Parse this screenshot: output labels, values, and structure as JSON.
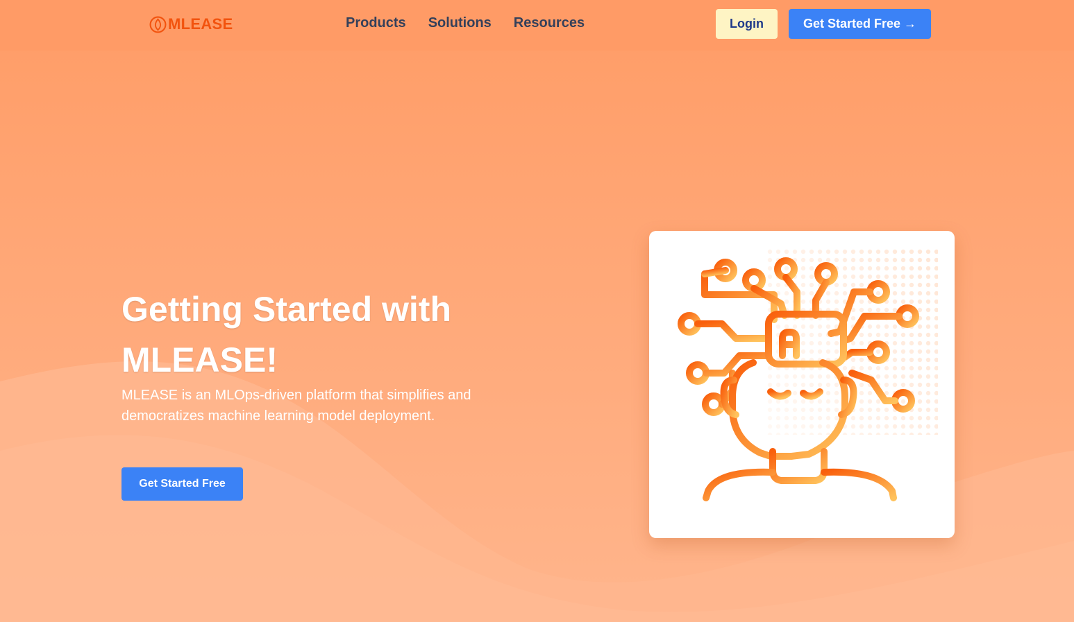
{
  "brand": {
    "name": "MLEASE",
    "logo_icon": "flame-drop-icon",
    "color": "#f2530e"
  },
  "nav": {
    "links": [
      {
        "label": "Products"
      },
      {
        "label": "Solutions"
      },
      {
        "label": "Resources"
      }
    ],
    "login_label": "Login",
    "cta_label": "Get Started Free →"
  },
  "hero": {
    "title": "Getting Started with MLEASE!",
    "description": "MLEASE is an MLOps-driven platform that simplifies and democratizes machine learning model deployment.",
    "cta_label": "Get Started Free",
    "illustration": {
      "icon": "ai-brain-head-icon",
      "badge_text": "AI"
    }
  },
  "colors": {
    "accent": "#3b82f6",
    "login_bg": "#fef4c4",
    "nav_text": "#34405a",
    "background": "#ffa878",
    "illustration_gradient_start": "#f95f0c",
    "illustration_gradient_end": "#ffc25c"
  }
}
